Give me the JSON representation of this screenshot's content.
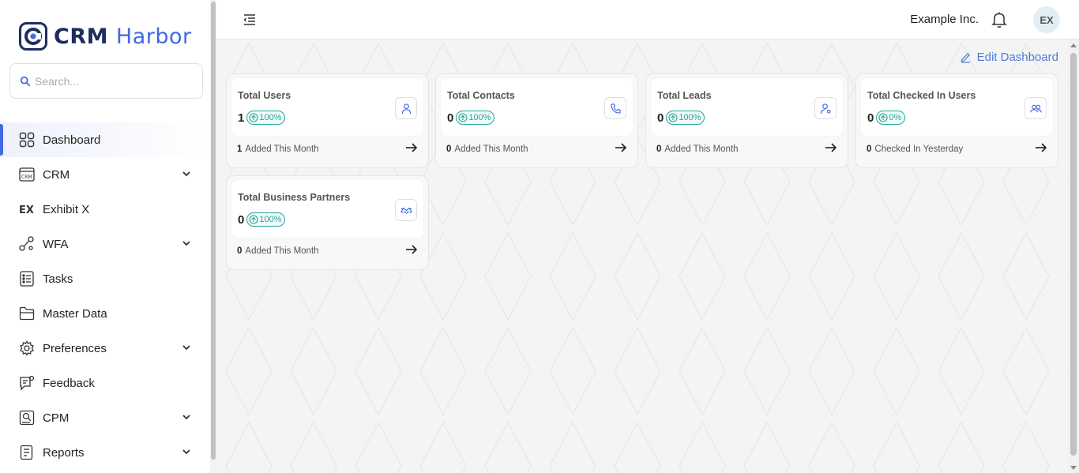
{
  "brand": {
    "part1": "CRM",
    "part2": "Harbor"
  },
  "search": {
    "placeholder": "Search..."
  },
  "nav": [
    {
      "label": "Dashboard",
      "icon": "dashboard-grid-icon",
      "active": true,
      "expandable": false
    },
    {
      "label": "CRM",
      "icon": "crm-monitor-icon",
      "expandable": true
    },
    {
      "label": "Exhibit X",
      "icon": "exhibit-x-icon",
      "expandable": false
    },
    {
      "label": "WFA",
      "icon": "workflow-icon",
      "expandable": true
    },
    {
      "label": "Tasks",
      "icon": "tasks-list-icon",
      "expandable": false
    },
    {
      "label": "Master Data",
      "icon": "folder-icon",
      "expandable": false
    },
    {
      "label": "Preferences",
      "icon": "gear-icon",
      "expandable": true
    },
    {
      "label": "Feedback",
      "icon": "feedback-icon",
      "expandable": false
    },
    {
      "label": "CPM",
      "icon": "cpm-icon",
      "expandable": true
    },
    {
      "label": "Reports",
      "icon": "reports-icon",
      "expandable": true
    }
  ],
  "header": {
    "company": "Example Inc.",
    "avatar": "EX"
  },
  "main": {
    "edit_label": "Edit Dashboard"
  },
  "cards": [
    {
      "title": "Total Users",
      "value": "1",
      "badge": "100%",
      "icon": "user-icon",
      "foot_value": "1",
      "foot_label": "Added This Month"
    },
    {
      "title": "Total Contacts",
      "value": "0",
      "badge": "100%",
      "icon": "phone-icon",
      "foot_value": "0",
      "foot_label": "Added This Month"
    },
    {
      "title": "Total Leads",
      "value": "0",
      "badge": "100%",
      "icon": "user-settings-icon",
      "foot_value": "0",
      "foot_label": "Added This Month"
    },
    {
      "title": "Total Checked In Users",
      "value": "0",
      "badge": "0%",
      "icon": "users-icon",
      "foot_value": "0",
      "foot_label": "Checked In Yesterday"
    },
    {
      "title": "Total Business Partners",
      "value": "0",
      "badge": "100%",
      "icon": "handshake-icon",
      "foot_value": "0",
      "foot_label": "Added This Month"
    }
  ],
  "colors": {
    "accent": "#4169e1",
    "badge": "#28a59a",
    "brand_dark": "#1e2d5f"
  }
}
